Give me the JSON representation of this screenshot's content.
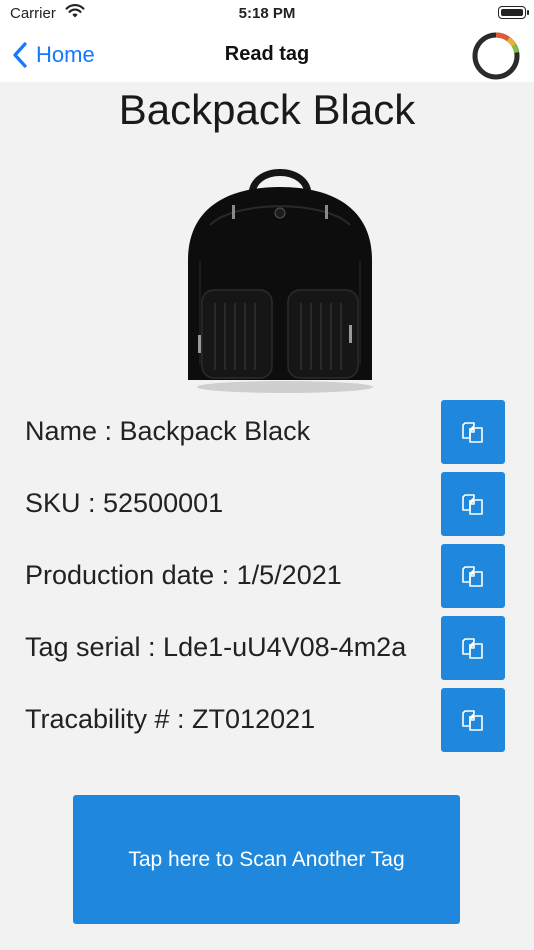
{
  "status_bar": {
    "carrier": "Carrier",
    "time": "5:18 PM"
  },
  "nav": {
    "back_label": "Home",
    "title": "Read tag"
  },
  "product": {
    "title": "Backpack Black",
    "image_alt_icon": "backpack-image"
  },
  "fields": [
    {
      "label": "Name : Backpack Black"
    },
    {
      "label": "SKU : 52500001"
    },
    {
      "label": "Production date : 1/5/2021"
    },
    {
      "label": "Tag serial : Lde1-uU4V08-4m2a"
    },
    {
      "label": "Tracability # : ZT012021"
    }
  ],
  "scan_button_label": "Tap here to Scan Another Tag",
  "colors": {
    "accent": "#2088dc",
    "ios_blue": "#1677ff",
    "background": "#f2f2f2"
  }
}
